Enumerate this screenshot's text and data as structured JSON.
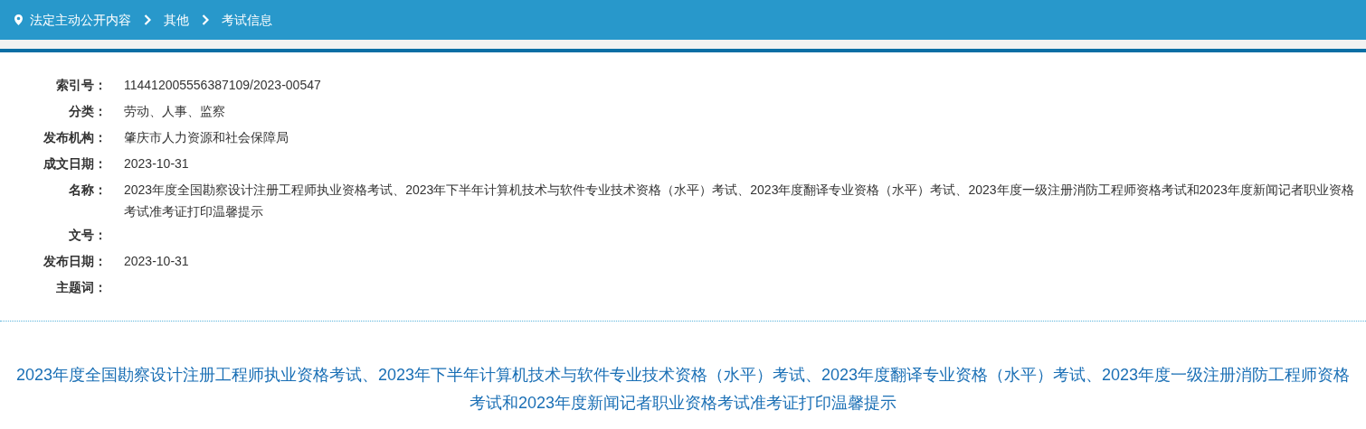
{
  "breadcrumb": [
    {
      "label": "法定主动公开内容"
    },
    {
      "label": "其他"
    },
    {
      "label": "考试信息"
    }
  ],
  "info": [
    {
      "label": "索引号：",
      "value": "114412005556387109/2023-00547"
    },
    {
      "label": "分类：",
      "value": "劳动、人事、监察"
    },
    {
      "label": "发布机构：",
      "value": "肇庆市人力资源和社会保障局"
    },
    {
      "label": "成文日期：",
      "value": "2023-10-31"
    },
    {
      "label": "名称：",
      "value": "2023年度全国勘察设计注册工程师执业资格考试、2023年下半年计算机技术与软件专业技术资格（水平）考试、2023年度翻译专业资格（水平）考试、2023年度一级注册消防工程师资格考试和2023年度新闻记者职业资格考试准考证打印温馨提示"
    },
    {
      "label": "文号："
    },
    {
      "label": "发布日期：",
      "value": "2023-10-31"
    },
    {
      "label": "主题词："
    }
  ],
  "article_title": "2023年度全国勘察设计注册工程师执业资格考试、2023年下半年计算机技术与软件专业技术资格（水平）考试、2023年度翻译专业资格（水平）考试、2023年度一级注册消防工程师资格考试和2023年度新闻记者职业资格考试准考证打印温馨提示"
}
